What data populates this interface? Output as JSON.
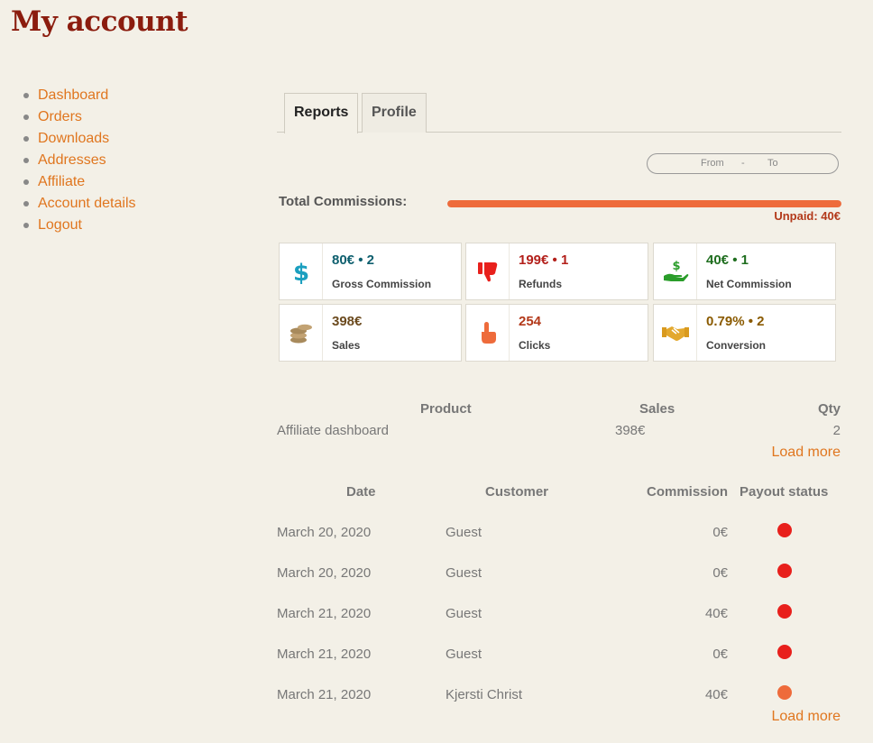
{
  "page": {
    "title": "My account"
  },
  "nav": {
    "items": [
      {
        "label": "Dashboard"
      },
      {
        "label": "Orders"
      },
      {
        "label": "Downloads"
      },
      {
        "label": "Addresses"
      },
      {
        "label": "Affiliate"
      },
      {
        "label": "Account details"
      },
      {
        "label": "Logout"
      }
    ]
  },
  "tabs": {
    "reports": "Reports",
    "profile": "Profile",
    "active": "Reports"
  },
  "date_range": {
    "from_placeholder": "From",
    "separator": "-",
    "to_placeholder": "To"
  },
  "commissions": {
    "label": "Total Commissions:",
    "progress_fraction": 1.0,
    "progress_color": "#ee6b3b",
    "unpaid": "Unpaid: 40€"
  },
  "cards": [
    {
      "icon": "dollar-icon",
      "value": "80€ • 2",
      "label": "Gross Commission",
      "color": "#0e5f6e"
    },
    {
      "icon": "thumbs-down-icon",
      "value": "199€ • 1",
      "label": "Refunds",
      "color": "#b3201b"
    },
    {
      "icon": "hand-money-icon",
      "value": "40€ • 1",
      "label": "Net Commission",
      "color": "#1f6e1f"
    },
    {
      "icon": "coins-icon",
      "value": "398€",
      "label": "Sales",
      "color": "#6b4a1e"
    },
    {
      "icon": "pointer-hand-icon",
      "value": "254",
      "label": "Clicks",
      "color": "#b3391a"
    },
    {
      "icon": "handshake-icon",
      "value": "0.79% • 2",
      "label": "Conversion",
      "color": "#8a5a00"
    }
  ],
  "products": {
    "headers": {
      "product": "Product",
      "sales": "Sales",
      "qty": "Qty"
    },
    "rows": [
      {
        "product": "Affiliate dashboard",
        "sales": "398€",
        "qty": "2"
      }
    ],
    "load_more": "Load more"
  },
  "referrals": {
    "headers": {
      "date": "Date",
      "customer": "Customer",
      "commission": "Commission",
      "payout_status": "Payout status"
    },
    "rows": [
      {
        "date": "March 20, 2020",
        "customer": "Guest",
        "commission": "0€",
        "status_color": "#e8201c"
      },
      {
        "date": "March 20, 2020",
        "customer": "Guest",
        "commission": "0€",
        "status_color": "#e8201c"
      },
      {
        "date": "March 21, 2020",
        "customer": "Guest",
        "commission": "40€",
        "status_color": "#e8201c"
      },
      {
        "date": "March 21, 2020",
        "customer": "Guest",
        "commission": "0€",
        "status_color": "#e8201c"
      },
      {
        "date": "March 21, 2020",
        "customer": "Kjersti Christ",
        "commission": "40€",
        "status_color": "#ee6b3b"
      }
    ],
    "load_more": "Load more"
  }
}
